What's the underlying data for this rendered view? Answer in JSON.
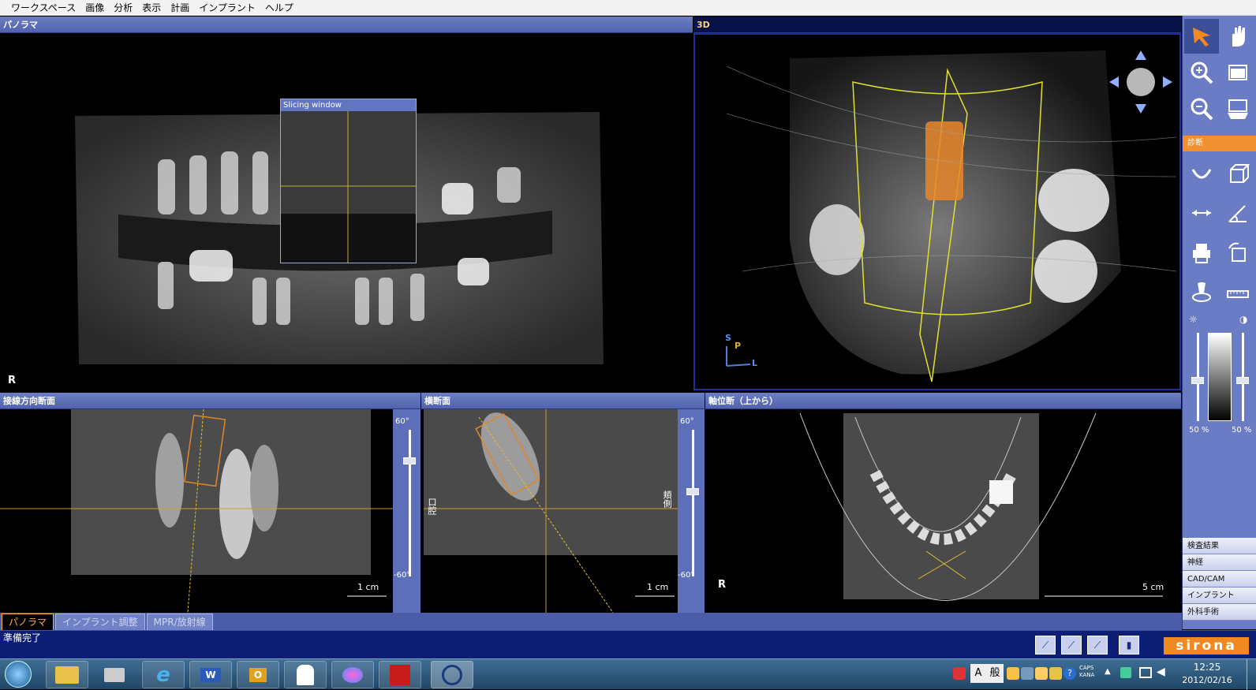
{
  "menu": [
    "ワークスペース",
    "画像",
    "分析",
    "表示",
    "計画",
    "インプラント",
    "ヘルプ"
  ],
  "panes": {
    "panorama": {
      "title": "パノラマ",
      "slicing_window": "Slicing window",
      "orientation": "R"
    },
    "view3d": {
      "title": "3D",
      "axis_s": "S",
      "axis_p": "P",
      "axis_l": "L"
    },
    "tangential": {
      "title": "接線方向断面",
      "angle_top": "60°",
      "angle_bottom": "-60°",
      "scale": "1 cm"
    },
    "cross": {
      "title": "横断面",
      "angle_top": "60°",
      "angle_bottom": "-60°",
      "scale": "1 cm",
      "side_left": "口腔",
      "side_right": "頬側"
    },
    "axial": {
      "title": "軸位断（上から）",
      "orientation": "R",
      "scale": "5 cm"
    }
  },
  "right_panel": {
    "tools": [
      "arrow-icon",
      "hand-icon",
      "zoom-in-icon",
      "zoom-out-icon",
      "view-front-icon",
      "view-down-icon"
    ],
    "section_label": "診断",
    "brightness_value": "50 %",
    "contrast_value": "50 %",
    "brightness_level": 0.5,
    "contrast_level": 0.5,
    "nav_items": [
      "検査結果",
      "神経",
      "CAD/CAM",
      "インプラント",
      "外科手術"
    ]
  },
  "tabs": [
    {
      "label": "パノラマ",
      "active": true
    },
    {
      "label": "インプラント調整",
      "active": false
    },
    {
      "label": "MPR/放射線",
      "active": false
    }
  ],
  "status": {
    "text": "準備完了",
    "brand": "sirona"
  },
  "taskbar": {
    "apps": [
      "start-orb",
      "explorer",
      "network",
      "ie",
      "word",
      "outlook",
      "dental-app",
      "paint",
      "pdf",
      "galileos"
    ],
    "ime_mode": "般",
    "indicator_caps": "CAPS",
    "indicator_kana": "KANA",
    "time": "12:25",
    "date": "2012/02/16"
  },
  "colors": {
    "accent": "#f0901e",
    "header": "#5a6db5",
    "status": "#0d1f74"
  }
}
